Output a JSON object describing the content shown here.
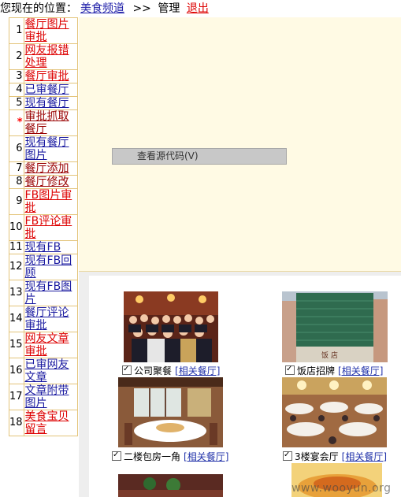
{
  "breadcrumb": {
    "prefix": "您现在的位置：",
    "channel": "美食频道",
    "sep": ">>",
    "current": "管理",
    "logout": "退出"
  },
  "sidebar": {
    "items": [
      {
        "num": "1",
        "label": "餐厅图片审批",
        "color": "#dd0000"
      },
      {
        "num": "2",
        "label": "网友报错处理",
        "color": "#dd0000"
      },
      {
        "num": "3",
        "label": "餐厅审批",
        "color": "#dd0000"
      },
      {
        "num": "4",
        "label": "已审餐厅",
        "color": "#1a1aa0"
      },
      {
        "num": "5",
        "label": "现有餐厅",
        "color": "#1a1aa0"
      },
      {
        "num": "*",
        "label": "审批抓取餐厅",
        "color": "#990000"
      },
      {
        "num": "6",
        "label": "现有餐厅图片",
        "color": "#1a1aa0"
      },
      {
        "num": "7",
        "label": "餐厅添加",
        "color": "#990000"
      },
      {
        "num": "8",
        "label": "餐厅修改",
        "color": "#990000"
      },
      {
        "num": "9",
        "label": "FB图片审批",
        "color": "#dd0000"
      },
      {
        "num": "10",
        "label": "FB评论审批",
        "color": "#dd0000"
      },
      {
        "num": "11",
        "label": "现有FB",
        "color": "#1a1aa0"
      },
      {
        "num": "12",
        "label": "现有FB回顾",
        "color": "#1a1aa0"
      },
      {
        "num": "13",
        "label": "现有FB图片",
        "color": "#1a1aa0"
      },
      {
        "num": "14",
        "label": "餐厅评论审批",
        "color": "#1a1aa0"
      },
      {
        "num": "15",
        "label": "网友文章审批",
        "color": "#dd0000"
      },
      {
        "num": "16",
        "label": "已审网友文章",
        "color": "#1a1aa0"
      },
      {
        "num": "17",
        "label": "文章附带图片",
        "color": "#1a1aa0"
      },
      {
        "num": "18",
        "label": "美食宝贝留言",
        "color": "#dd0000"
      }
    ]
  },
  "view_source_button": "查看源代码(V)",
  "gallery": {
    "photos": [
      {
        "caption": "公司聚餐",
        "link": "[相关餐厅]",
        "scene": "group"
      },
      {
        "caption": "饭店招牌",
        "link": "[相关餐厅]",
        "scene": "building"
      },
      {
        "caption": "二楼包房一角",
        "link": "[相关餐厅]",
        "scene": "privateroom"
      },
      {
        "caption": "3楼宴会厅",
        "link": "[相关餐厅]",
        "scene": "banquet"
      }
    ]
  },
  "watermark": "www.wooyun.org"
}
